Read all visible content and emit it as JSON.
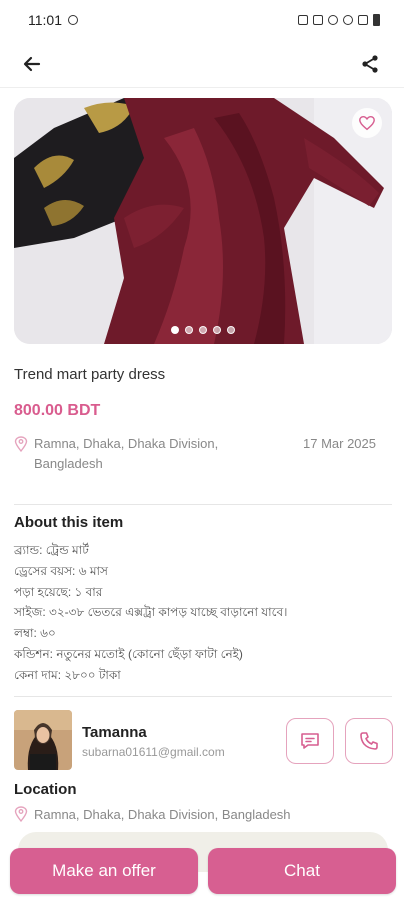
{
  "status_bar": {
    "time": "11:01"
  },
  "product": {
    "title": "Trend mart party dress",
    "price": "800.00 BDT",
    "location": "Ramna, Dhaka, Dhaka Division, Bangladesh",
    "date": "17 Mar 2025",
    "image_count": 5,
    "active_image": 0
  },
  "about": {
    "title": "About this item",
    "lines": [
      "ব্র্যান্ড: ট্রেন্ড মার্ট",
      "ড্রেসের বয়স: ৬ মাস",
      "পড়া হয়েছে: ১ বার",
      "সাইজ: ৩২-৩৮ ভেতরে এক্সট্রা কাপড় যাচ্ছে বাড়ানো যাবে।",
      "লম্বা: ৬০",
      "কন্ডিশন: নতুনের মতোই (কোনো ছেঁড়া ফাটা নেই)",
      "কেনা দাম: ২৮০০ টাকা"
    ]
  },
  "seller": {
    "name": "Tamanna",
    "email": "subarna01611@gmail.com"
  },
  "location_section": {
    "title": "Location",
    "address": "Ramna, Dhaka, Dhaka Division, Bangladesh"
  },
  "buttons": {
    "offer": "Make an offer",
    "chat": "Chat"
  },
  "colors": {
    "accent": "#d75f91",
    "price": "#d95c8e",
    "outline": "#e5a3bd"
  },
  "icons": {
    "back": "arrow-left-icon",
    "share": "share-icon",
    "favorite": "heart-icon",
    "location": "map-pin-icon",
    "chat": "message-icon",
    "call": "phone-icon"
  }
}
